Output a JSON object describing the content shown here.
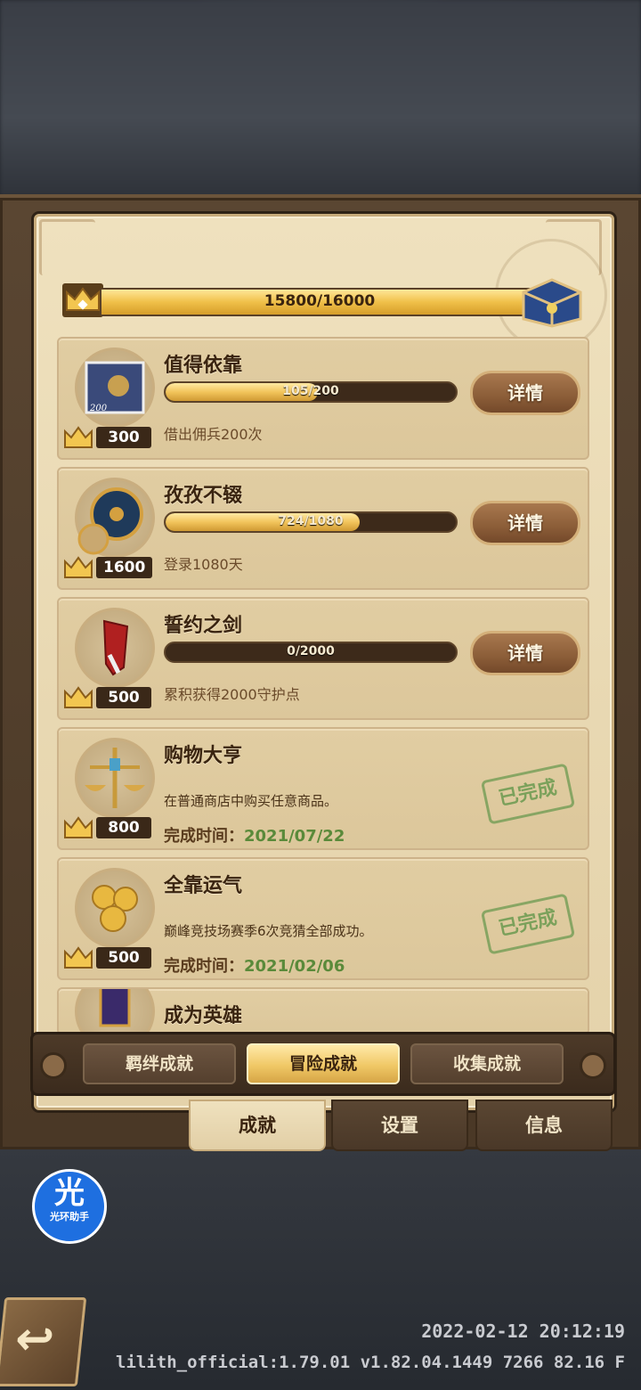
{
  "total": {
    "value": 15800,
    "max": 16000,
    "text": "15800/16000"
  },
  "achievements": [
    {
      "title": "值得依靠",
      "progress_text": "105/200",
      "progress": 0.525,
      "desc": "借出佣兵200次",
      "reward": "300",
      "button": "详情",
      "icon": "mercenary-stamp-icon",
      "icon_label": "200"
    },
    {
      "title": "孜孜不辍",
      "progress_text": "724/1080",
      "progress": 0.67,
      "desc": "登录1080天",
      "reward": "1600",
      "button": "详情",
      "icon": "pocket-watch-icon"
    },
    {
      "title": "誓约之剑",
      "progress_text": "0/2000",
      "progress": 0.0,
      "desc": "累积获得2000守护点",
      "reward": "500",
      "button": "详情",
      "icon": "sword-icon"
    },
    {
      "title": "购物大亨",
      "desc": "在普通商店中购买任意商品。",
      "time_label": "完成时间：",
      "time": "2021/07/22",
      "reward": "800",
      "stamp": "已完成",
      "icon": "scales-icon"
    },
    {
      "title": "全靠运气",
      "desc": "巅峰竞技场赛季6次竞猜全部成功。",
      "time_label": "完成时间：",
      "time": "2021/02/06",
      "reward": "500",
      "stamp": "已完成",
      "icon": "gold-coins-icon"
    },
    {
      "title": "成为英雄",
      "icon": "banner-icon"
    }
  ],
  "subtabs": [
    "羁绊成就",
    "冒险成就",
    "收集成就"
  ],
  "subtab_active": 1,
  "main_tabs": [
    "成就",
    "设置",
    "信息"
  ],
  "main_tab_active": 0,
  "helper": {
    "big": "光",
    "small": "光环助手"
  },
  "footer": {
    "time": "2022-02-12 20:12:19",
    "version": "lilith_official:1.79.01  v1.82.04.1449 7266 82.16 F"
  },
  "colors": {
    "gold": "#f0c049",
    "parchment": "#e9d9b3",
    "complete_green": "#5a8a3a",
    "frame_brown": "#4a3826"
  }
}
